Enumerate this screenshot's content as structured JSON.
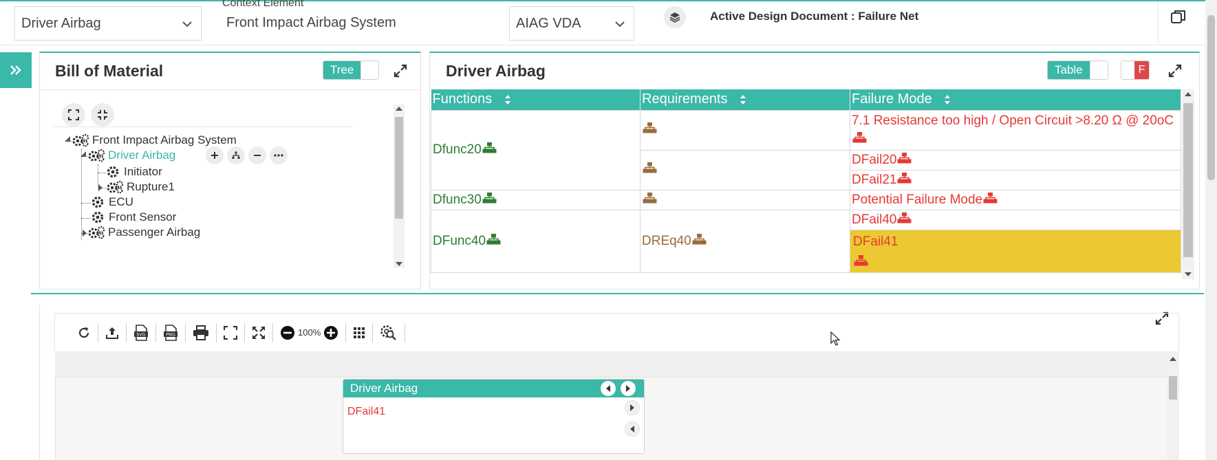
{
  "topbar": {
    "product_select": "Driver Airbag",
    "context_label": "Context Element",
    "context_value": "Front Impact Airbag System",
    "standard_select": "AIAG VDA",
    "active_doc": "Active Design Document : Failure Net"
  },
  "bom": {
    "title": "Bill of Material",
    "toggle_label": "Tree",
    "tree": {
      "root": "Front Impact Airbag System",
      "driver_airbag": "Driver Airbag",
      "initiator": "Initiator",
      "rupture": "Rupture1",
      "ecu": "ECU",
      "front_sensor": "Front Sensor",
      "passenger_airbag": "Passenger Airbag"
    }
  },
  "detail": {
    "title": "Driver Airbag",
    "toggle_label": "Table",
    "f_label": "F",
    "columns": [
      "Functions",
      "Requirements",
      "Failure Mode"
    ],
    "functions": [
      "Dfunc20",
      "Dfunc30",
      "DFunc40"
    ],
    "requirements": [
      "DREq40"
    ],
    "failure_modes": [
      "7.1 Resistance too high / Open Circuit >8.20 Ω @ 20oC",
      "DFail20",
      "DFail21",
      "Potential Failure Mode",
      "DFail40",
      "DFail41"
    ]
  },
  "diagram": {
    "zoom": "100%",
    "node": {
      "title": "Driver Airbag",
      "item": "DFail41"
    }
  },
  "colors": {
    "accent": "#3ab8a8",
    "function_green": "#2e7d32",
    "requirement_brown": "#9b6b3d",
    "failure_red": "#e53935",
    "highlight": "#ecc932"
  }
}
